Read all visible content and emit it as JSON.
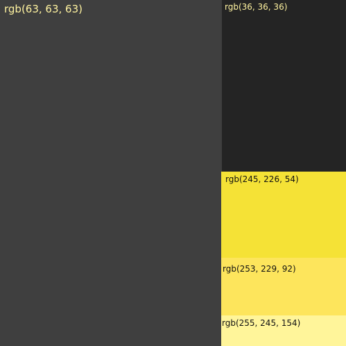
{
  "swatches": [
    {
      "label": "rgb(63, 63, 63)",
      "color": "#3f3f3f"
    },
    {
      "label": "rgb(36, 36, 36)",
      "color": "#242424"
    },
    {
      "label": "rgb(245, 226, 54)",
      "color": "#f5e236"
    },
    {
      "label": "rgb(253, 229, 92)",
      "color": "#fde55c"
    },
    {
      "label": "rgb(255, 245, 154)",
      "color": "#fff59a"
    }
  ],
  "label_colors": {
    "on_dark": "#fff3a0",
    "on_light": "#111111"
  }
}
